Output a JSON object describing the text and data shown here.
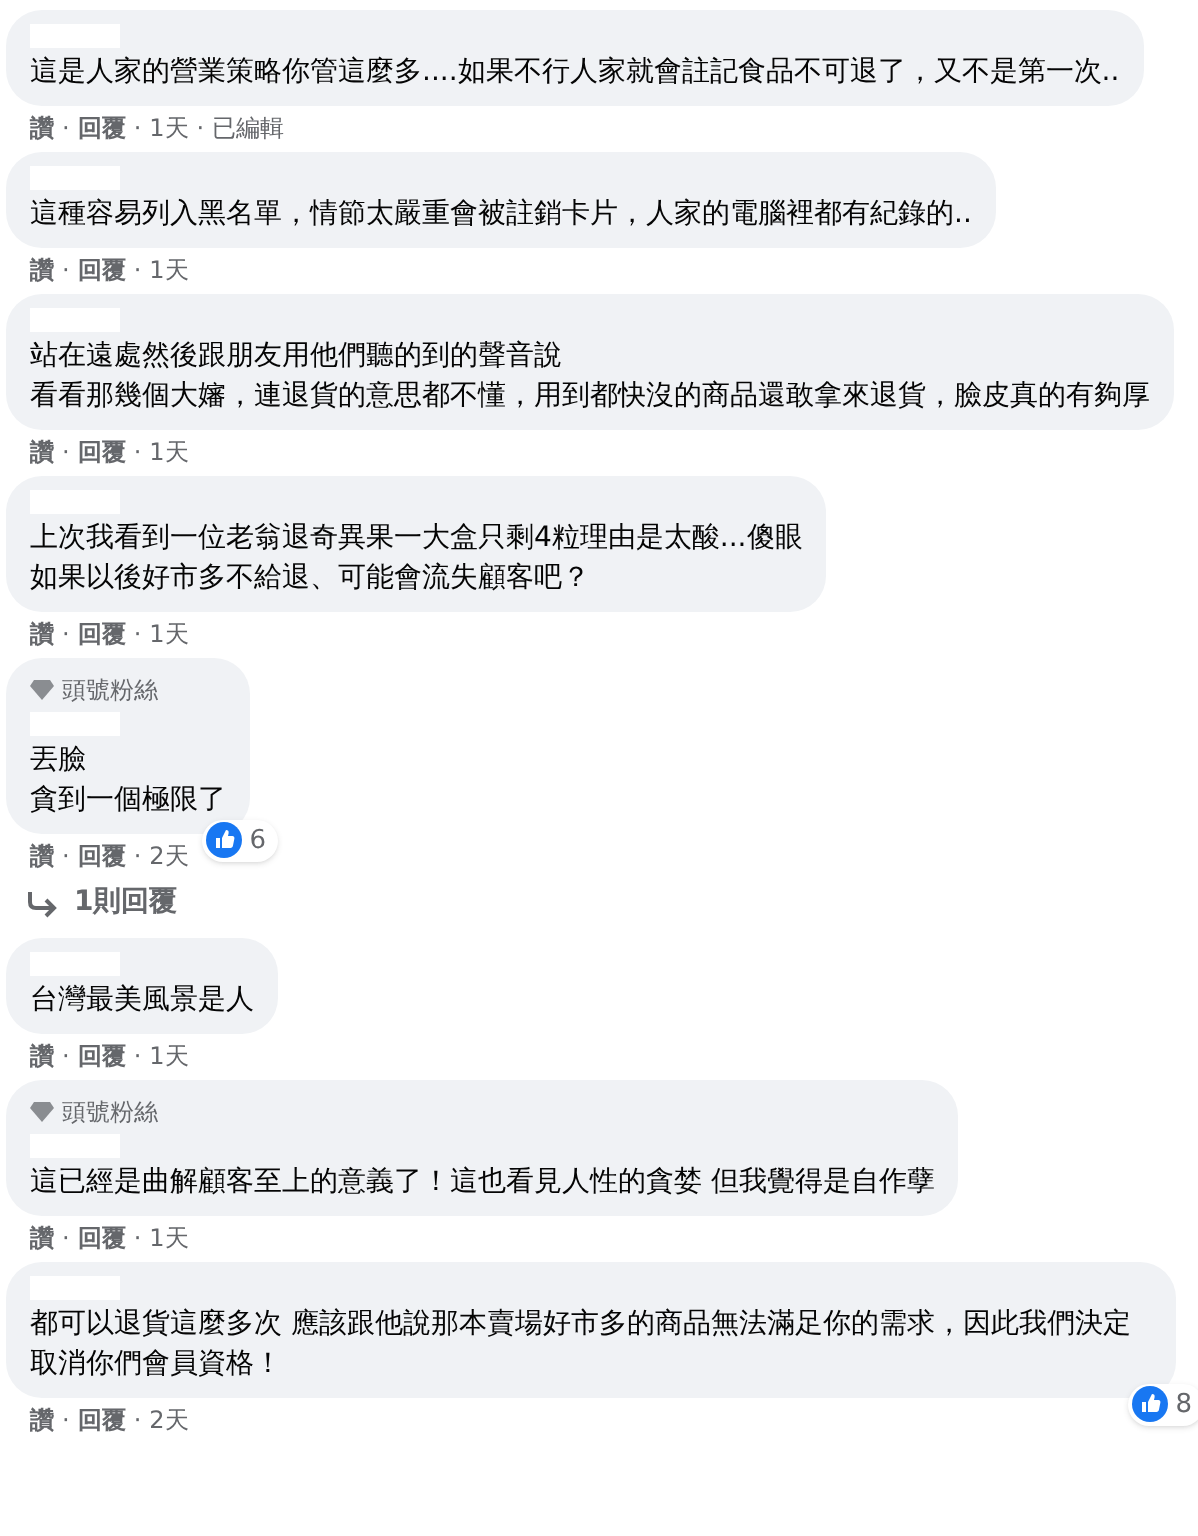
{
  "separator": "·",
  "comments": [
    {
      "lines": [
        "這是人家的營業策略你管這麼多....如果不行人家就會註記食品不可退了，又不是第一次.."
      ],
      "actions": [
        "讚",
        "回覆",
        "1天",
        "已編輯"
      ]
    },
    {
      "lines": [
        "這種容易列入黑名單，情節太嚴重會被註銷卡片，人家的電腦裡都有紀錄的.."
      ],
      "actions": [
        "讚",
        "回覆",
        "1天"
      ]
    },
    {
      "lines": [
        "站在遠處然後跟朋友用他們聽的到的聲音說",
        "看看那幾個大嬸，連退貨的意思都不懂，用到都快沒的商品還敢拿來退貨，臉皮真的有夠厚"
      ],
      "actions": [
        "讚",
        "回覆",
        "1天"
      ]
    },
    {
      "lines": [
        "上次我看到一位老翁退奇異果一大盒只剩4粒理由是太酸...傻眼",
        "如果以後好市多不給退、可能會流失顧客吧？"
      ],
      "actions": [
        "讚",
        "回覆",
        "1天"
      ]
    },
    {
      "badge": "頭號粉絲",
      "lines": [
        "丟臉",
        "貪到一個極限了"
      ],
      "actions": [
        "讚",
        "回覆",
        "2天"
      ],
      "reactions": "6",
      "replies": "1則回覆"
    },
    {
      "lines": [
        "台灣最美風景是人"
      ],
      "actions": [
        "讚",
        "回覆",
        "1天"
      ]
    },
    {
      "badge": "頭號粉絲",
      "lines": [
        "這已經是曲解顧客至上的意義了！這也看見人性的貪婪 但我覺得是自作孽"
      ],
      "actions": [
        "讚",
        "回覆",
        "1天"
      ]
    },
    {
      "lines": [
        "都可以退貨這麼多次 應該跟他說那本賣場好市多的商品無法滿足你的需求，因此我們決定取消你們會員資格！"
      ],
      "actions": [
        "讚",
        "回覆",
        "2天"
      ],
      "reactions": "8"
    }
  ]
}
